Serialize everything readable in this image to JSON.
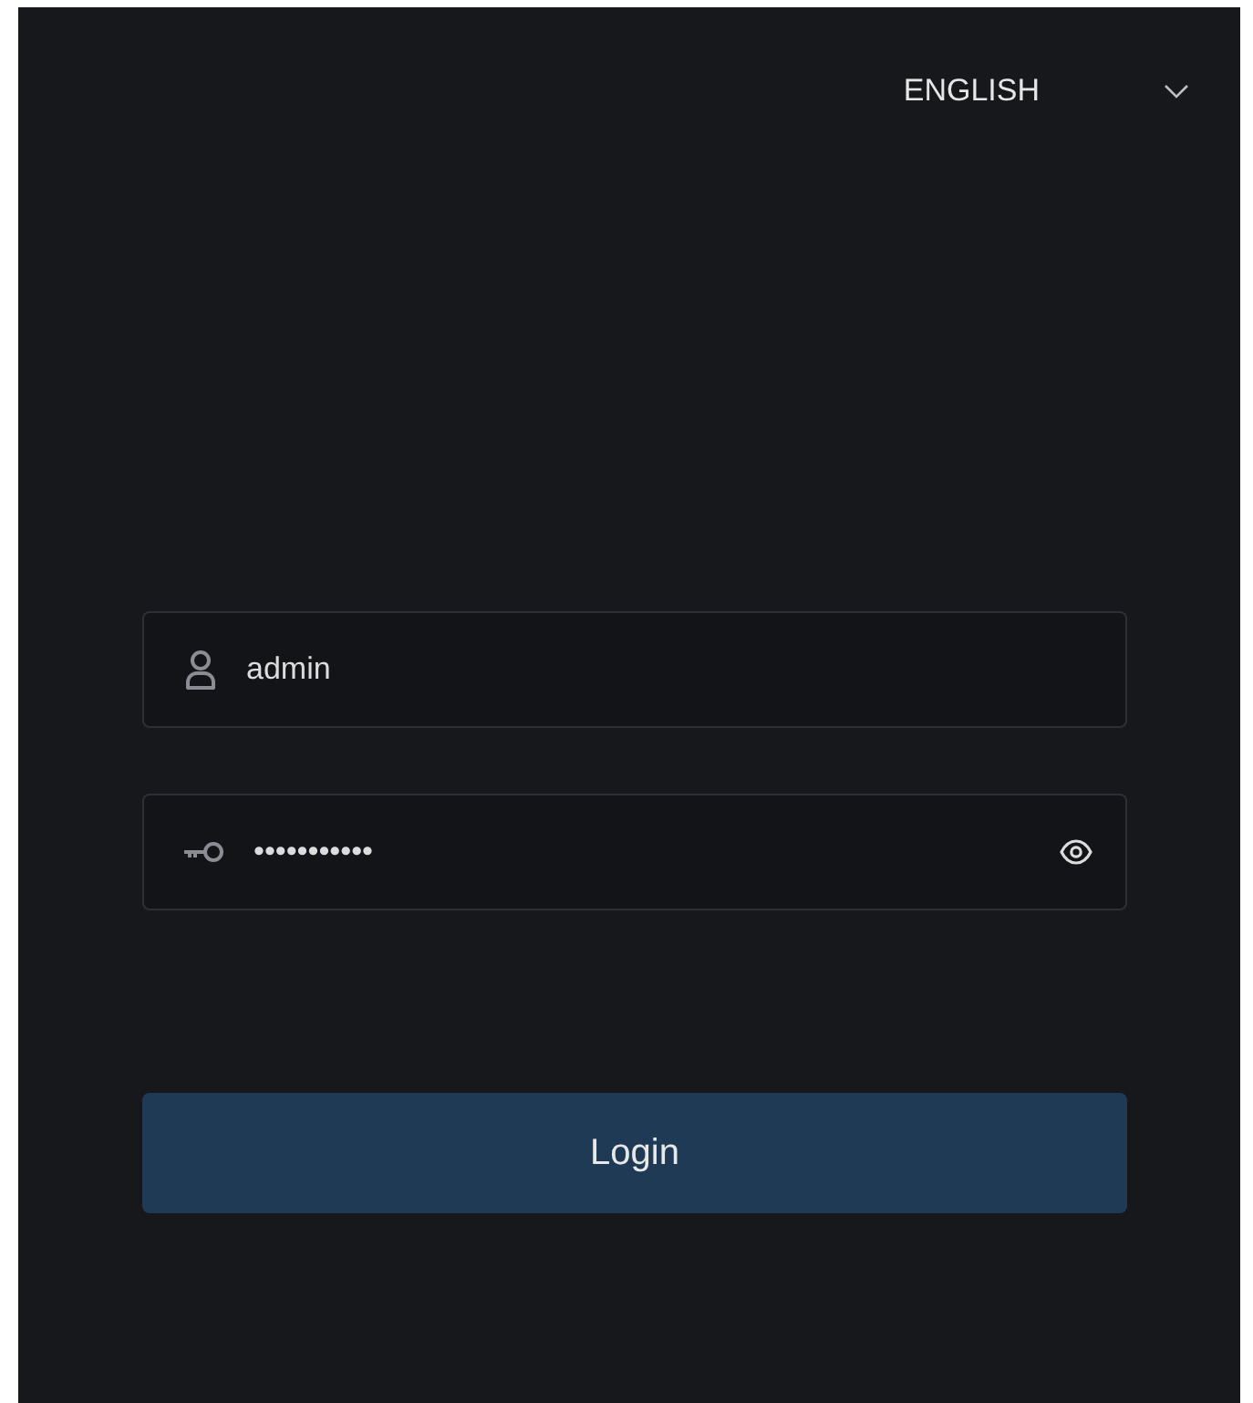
{
  "language_selector": {
    "value": "ENGLISH"
  },
  "username": {
    "value": "admin"
  },
  "password": {
    "value": "•••••••••••"
  },
  "login_button": {
    "label": "Login"
  }
}
